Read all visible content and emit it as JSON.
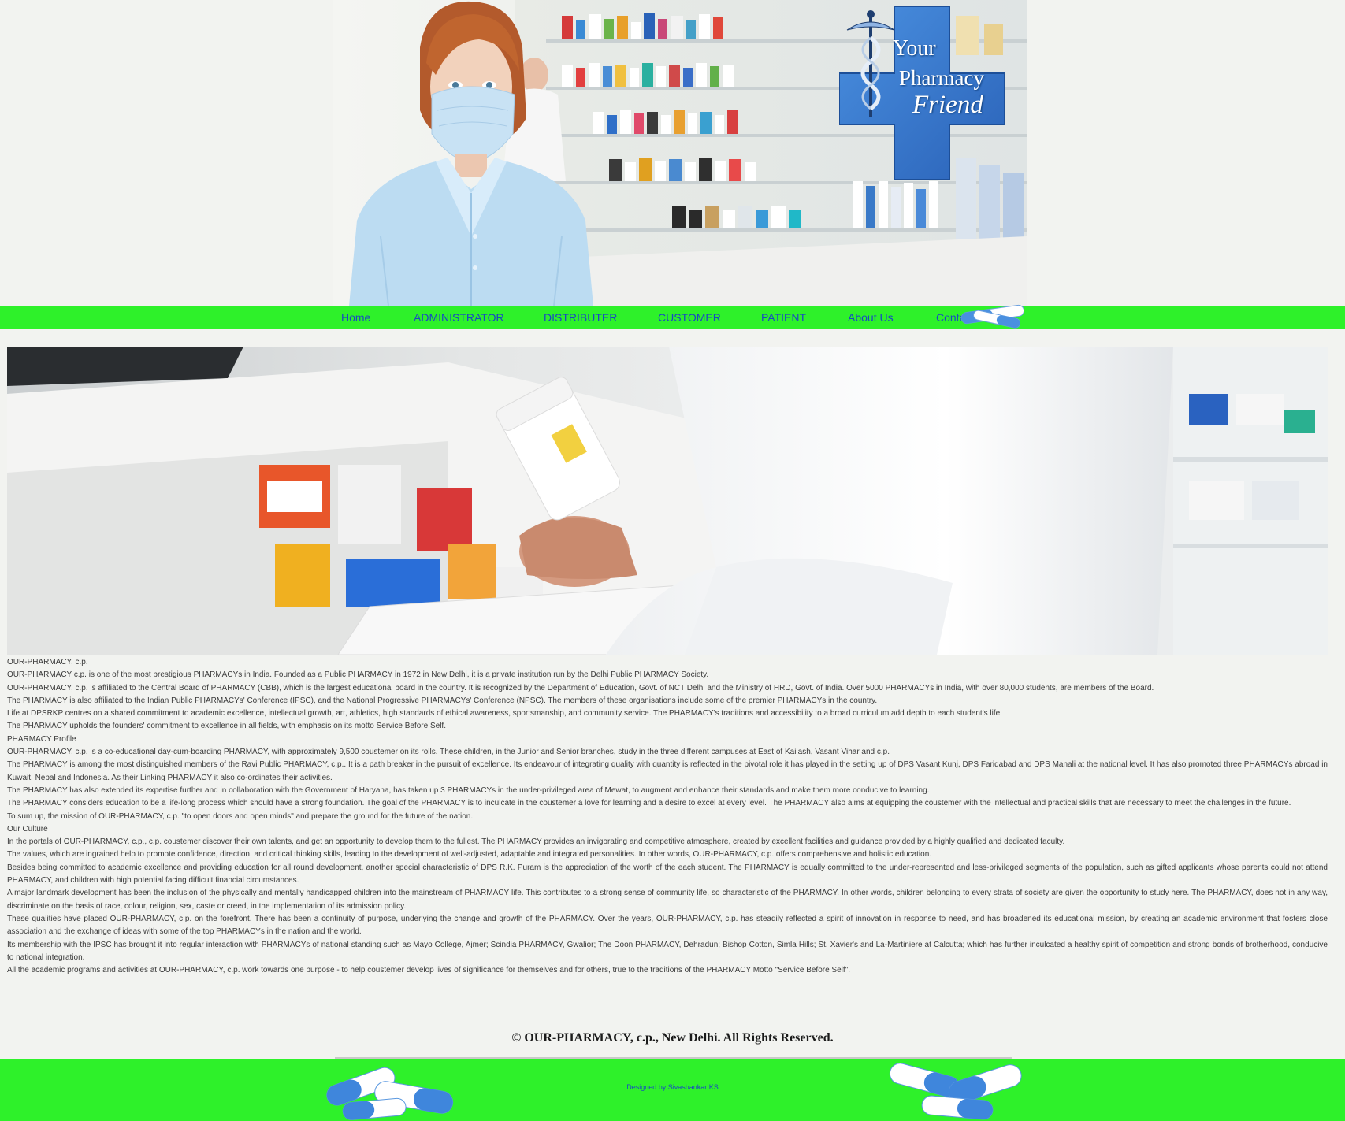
{
  "logo": {
    "line1": "Your",
    "line2": "Pharmacy",
    "line3": "Friend"
  },
  "nav": {
    "items": [
      {
        "label": "Home"
      },
      {
        "label": "ADMINISTRATOR"
      },
      {
        "label": "DISTRIBUTER"
      },
      {
        "label": "CUSTOMER"
      },
      {
        "label": "PATIENT"
      },
      {
        "label": "About Us"
      },
      {
        "label": "Contact Us"
      }
    ]
  },
  "article": {
    "paragraphs": [
      "OUR-PHARMACY, c.p.",
      "OUR-PHARMACY c.p. is one of the most prestigious PHARMACYs in India. Founded as a Public PHARMACY in 1972 in New Delhi, it is a private institution run by the Delhi Public PHARMACY Society.",
      "OUR-PHARMACY, c.p. is affiliated to the Central Board of PHARMACY (CBB), which is the largest educational board in the country. It is recognized by the Department of Education, Govt. of NCT Delhi and the Ministry of HRD, Govt. of India. Over 5000 PHARMACYs in India, with over 80,000 students, are members of the Board.",
      "The PHARMACY is also affiliated to the Indian Public PHARMACYs' Conference (IPSC), and the National Progressive PHARMACYs' Conference (NPSC). The members of these organisations include some of the premier PHARMACYs in the country.",
      "Life at DPSRKP centres on a shared commitment to academic excellence, intellectual growth, art, athletics, high standards of ethical awareness, sportsmanship, and community service. The PHARMACY's traditions and accessibility to a broad curriculum add depth to each student's life.",
      "The PHARMACY upholds the founders' commitment to excellence in all fields, with emphasis on its motto Service Before Self.",
      "PHARMACY Profile",
      "OUR-PHARMACY, c.p. is a co-educational day-cum-boarding PHARMACY, with approximately 9,500 coustemer on its rolls. These children, in the Junior and Senior branches, study in the three different campuses at East of Kailash, Vasant Vihar and c.p.",
      "The PHARMACY is among the most distinguished members of the Ravi Public PHARMACY, c.p.. It is a path breaker in the pursuit of excellence. Its endeavour of integrating quality with quantity is reflected in the pivotal role it has played in the setting up of DPS Vasant Kunj, DPS Faridabad and DPS Manali at the national level. It has also promoted three PHARMACYs abroad in Kuwait, Nepal and Indonesia. As their Linking PHARMACY it also co-ordinates their activities.",
      "The PHARMACY has also extended its expertise further and in collaboration with the Government of Haryana, has taken up 3 PHARMACYs in the under-privileged area of Mewat, to augment and enhance their standards and make them more conducive to learning.",
      "The PHARMACY considers education to be a life-long process which should have a strong foundation. The goal of the PHARMACY is to inculcate in the coustemer a love for learning and a desire to excel at every level. The PHARMACY also aims at equipping the coustemer with the intellectual and practical skills that are necessary to meet the challenges in the future.",
      "To sum up, the mission of OUR-PHARMACY, c.p. \"to open doors and open minds\" and prepare the ground for the future of the nation.",
      "Our Culture",
      "In the portals of OUR-PHARMACY, c.p., c.p. coustemer discover their own talents, and get an opportunity to develop them to the fullest. The PHARMACY provides an invigorating and competitive atmosphere, created by excellent facilities and guidance provided by a highly qualified and dedicated faculty.",
      "The values, which are ingrained help to promote confidence, direction, and critical thinking skills, leading to the development of well-adjusted, adaptable and integrated personalities. In other words, OUR-PHARMACY, c.p. offers comprehensive and holistic education.",
      "Besides being committed to academic excellence and providing education for all round development, another special characteristic of DPS R.K. Puram is the appreciation of the worth of the each student. The PHARMACY is equally committed to the under-represented and less-privileged segments of the population, such as gifted applicants whose parents could not attend PHARMACY, and children with high potential facing difficult financial circumstances.",
      "A major landmark development has been the inclusion of the physically and mentally handicapped children into the mainstream of PHARMACY life. This contributes to a strong sense of community life, so characteristic of the PHARMACY. In other words, children belonging to every strata of society are given the opportunity to study here. The PHARMACY, does not in any way, discriminate on the basis of race, colour, religion, sex, caste or creed, in the implementation of its admission policy.",
      "These qualities have placed OUR-PHARMACY, c.p. on the forefront. There has been a continuity of purpose, underlying the change and growth of the PHARMACY. Over the years, OUR-PHARMACY, c.p. has steadily reflected a spirit of innovation in response to need, and has broadened its educational mission, by creating an academic environment that fosters close association and the exchange of ideas with some of the top PHARMACYs in the nation and the world.",
      "Its membership with the IPSC has brought it into regular interaction with PHARMACYs of national standing such as Mayo College, Ajmer; Scindia PHARMACY, Gwalior; The Doon PHARMACY, Dehradun; Bishop Cotton, Simla Hills; St. Xavier's and La-Martiniere at Calcutta; which has further inculcated a healthy spirit of competition and strong bonds of brotherhood, conducive to national integration.",
      "All the academic programs and activities at OUR-PHARMACY, c.p. work towards one purpose - to help coustemer develop lives of significance for themselves and for others, true to the traditions of the PHARMACY Motto \"Service Before Self\"."
    ]
  },
  "footer": {
    "copyright": "© OUR-PHARMACY, c.p., New Delhi. All Rights Reserved.",
    "designed_by": "Designed by Sivashankar KS"
  },
  "colors": {
    "nav_green": "#2ef12a",
    "link_blue": "#1849c4",
    "page_bg": "#f2f3f0",
    "logo_blue": "#2f78d2"
  }
}
